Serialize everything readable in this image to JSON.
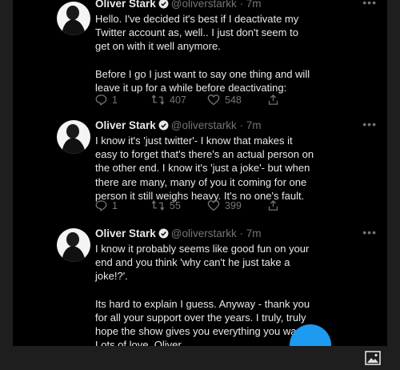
{
  "colors": {
    "page_bg": "#1e1e1e",
    "tweet_bg": "#000000",
    "text": "#e7e9ea",
    "muted": "#71767b",
    "verified": "#e7e9ea",
    "accent": "#1d9bf0"
  },
  "tweets": [
    {
      "name": "Oliver Stark",
      "handle": "@oliverstarkk",
      "sep": " · ",
      "time": "7m",
      "more": "•••",
      "text": "Hello. I've decided it's best if I deactivate my\nTwitter account as, well.. I just don't seem to\nget on with it well anymore.\n\nBefore I go I just want to say one thing and will\nleave it up for a while before deactivating:",
      "replies": "1",
      "retweets": "407",
      "likes": "548"
    },
    {
      "name": "Oliver Stark",
      "handle": "@oliverstarkk",
      "sep": " · ",
      "time": "7m",
      "more": "•••",
      "text": "I know it's 'just twitter'-  I know that makes it\neasy to forget that's there's an actual person on\nthe other end. I know it's 'just a joke'- but when\nthere are many, many of you it coming for one\nperson it still weighs heavy. It's no one's fault.",
      "replies": "1",
      "retweets": "55",
      "likes": "399"
    },
    {
      "name": "Oliver Stark",
      "handle": "@oliverstarkk",
      "sep": " · ",
      "time": "7m",
      "more": "•••",
      "text": "I know it probably seems like good fun on your\nend and you think 'why can't he just take a\njoke!?'.\n\nIts hard to explain I guess. Anyway - thank you\nfor all your support over the years. I truly, truly\nhope the show gives you everything you want.\nLots of love, Oliver."
    }
  ],
  "icons": {
    "reply": "reply-icon",
    "retweet": "retweet-icon",
    "like": "heart-icon",
    "share": "share-icon",
    "verified": "verified-badge-icon",
    "image": "image-icon"
  }
}
